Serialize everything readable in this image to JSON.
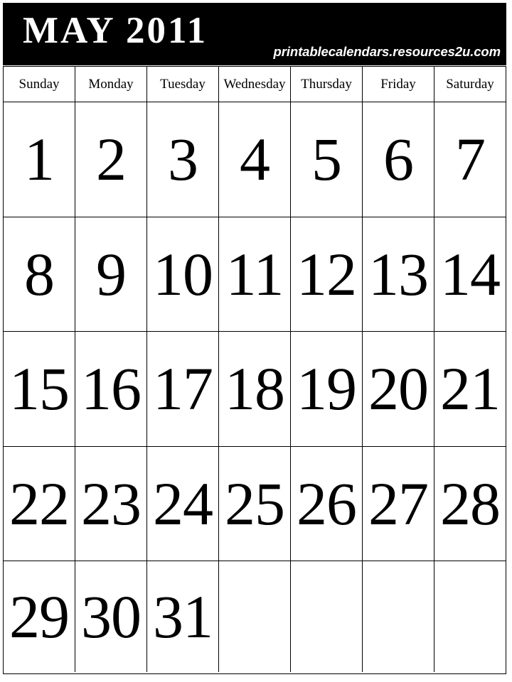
{
  "masthead": {
    "title": "MAY 2011",
    "website": "printablecalendars.resources2u.com",
    "background_color": "#000000",
    "text_color": "#ffffff"
  },
  "calendar": {
    "month": "MAY",
    "year": "2011",
    "weekday_headers": [
      "Sunday",
      "Monday",
      "Tuesday",
      "Wednesday",
      "Thursday",
      "Friday",
      "Saturday"
    ],
    "weeks": [
      [
        "1",
        "2",
        "3",
        "4",
        "5",
        "6",
        "7"
      ],
      [
        "8",
        "9",
        "10",
        "11",
        "12",
        "13",
        "14"
      ],
      [
        "15",
        "16",
        "17",
        "18",
        "19",
        "20",
        "21"
      ],
      [
        "22",
        "23",
        "24",
        "25",
        "26",
        "27",
        "28"
      ],
      [
        "29",
        "30",
        "31",
        "",
        "",
        "",
        ""
      ]
    ],
    "grid_line_color": "#000000",
    "cell_background": "#ffffff"
  }
}
